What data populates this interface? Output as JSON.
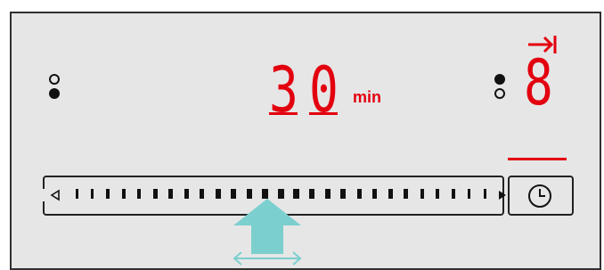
{
  "colors": {
    "panel": "#e6e6e6",
    "display_red": "#e3000f",
    "outline": "#222222",
    "gesture_arrow": "#7ccfcf"
  },
  "display": {
    "duration_digit_1": "3",
    "duration_digit_2": "0",
    "duration_unit": "min",
    "cooking_zone_digit": "8"
  },
  "icons": {
    "zone_left": "zone-indicator-open-over-filled",
    "zone_right": "zone-indicator-filled-over-open",
    "timer_end": "timer-end-arrow-icon",
    "timer_button": "clock-icon",
    "slider_left": "triangle-left-open-icon",
    "slider_right": "triangle-right-filled-icon",
    "gesture": "swipe-up-arrow-icon"
  },
  "slider": {
    "segments": 27,
    "highlighted_segment": 10
  }
}
